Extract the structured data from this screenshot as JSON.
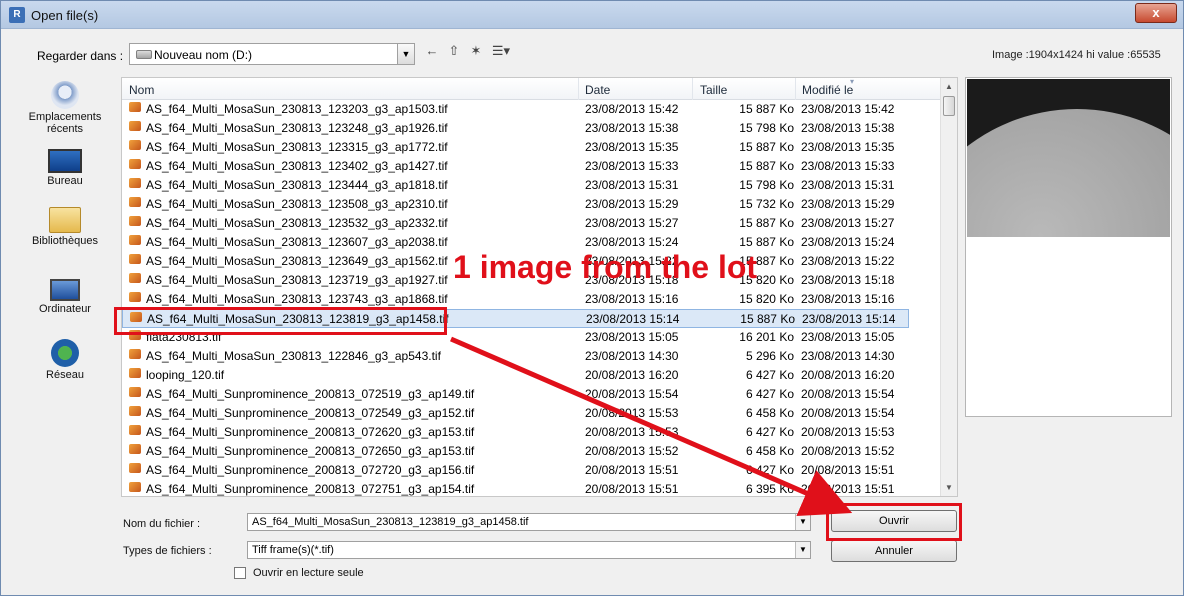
{
  "window": {
    "title": "Open file(s)",
    "app_icon": "R",
    "close": "x"
  },
  "lookin": {
    "label": "Regarder dans :",
    "value": "Nouveau nom (D:)"
  },
  "toolbar": {
    "back": "←",
    "up": "⇧",
    "newfolder": "✶",
    "views": "☰▾"
  },
  "imageinfo": "Image :1904x1424 hi value :65535",
  "places": [
    {
      "label": "Emplacements récents",
      "icon": "recent-places-icon"
    },
    {
      "label": "Bureau",
      "icon": "desktop-icon"
    },
    {
      "label": "Bibliothèques",
      "icon": "libraries-icon"
    },
    {
      "label": "Ordinateur",
      "icon": "computer-icon"
    },
    {
      "label": "Réseau",
      "icon": "network-icon"
    }
  ],
  "columns": {
    "name": "Nom",
    "date": "Date",
    "size": "Taille",
    "modified": "Modifié le"
  },
  "files": [
    {
      "name": "AS_f64_Multi_MosaSun_230813_123203_g3_ap1503.tif",
      "date": "23/08/2013 15:42",
      "size": "15 887 Ko",
      "modified": "23/08/2013 15:42"
    },
    {
      "name": "AS_f64_Multi_MosaSun_230813_123248_g3_ap1926.tif",
      "date": "23/08/2013 15:38",
      "size": "15 798 Ko",
      "modified": "23/08/2013 15:38"
    },
    {
      "name": "AS_f64_Multi_MosaSun_230813_123315_g3_ap1772.tif",
      "date": "23/08/2013 15:35",
      "size": "15 887 Ko",
      "modified": "23/08/2013 15:35"
    },
    {
      "name": "AS_f64_Multi_MosaSun_230813_123402_g3_ap1427.tif",
      "date": "23/08/2013 15:33",
      "size": "15 887 Ko",
      "modified": "23/08/2013 15:33"
    },
    {
      "name": "AS_f64_Multi_MosaSun_230813_123444_g3_ap1818.tif",
      "date": "23/08/2013 15:31",
      "size": "15 798 Ko",
      "modified": "23/08/2013 15:31"
    },
    {
      "name": "AS_f64_Multi_MosaSun_230813_123508_g3_ap2310.tif",
      "date": "23/08/2013 15:29",
      "size": "15 732 Ko",
      "modified": "23/08/2013 15:29"
    },
    {
      "name": "AS_f64_Multi_MosaSun_230813_123532_g3_ap2332.tif",
      "date": "23/08/2013 15:27",
      "size": "15 887 Ko",
      "modified": "23/08/2013 15:27"
    },
    {
      "name": "AS_f64_Multi_MosaSun_230813_123607_g3_ap2038.tif",
      "date": "23/08/2013 15:24",
      "size": "15 887 Ko",
      "modified": "23/08/2013 15:24"
    },
    {
      "name": "AS_f64_Multi_MosaSun_230813_123649_g3_ap1562.tif",
      "date": "23/08/2013 15:22",
      "size": "15 887 Ko",
      "modified": "23/08/2013 15:22"
    },
    {
      "name": "AS_f64_Multi_MosaSun_230813_123719_g3_ap1927.tif",
      "date": "23/08/2013 15:18",
      "size": "15 820 Ko",
      "modified": "23/08/2013 15:18"
    },
    {
      "name": "AS_f64_Multi_MosaSun_230813_123743_g3_ap1868.tif",
      "date": "23/08/2013 15:16",
      "size": "15 820 Ko",
      "modified": "23/08/2013 15:16"
    },
    {
      "name": "AS_f64_Multi_MosaSun_230813_123819_g3_ap1458.tif",
      "date": "23/08/2013 15:14",
      "size": "15 887 Ko",
      "modified": "23/08/2013 15:14",
      "selected": true
    },
    {
      "name": "flata230813.tif",
      "date": "23/08/2013 15:05",
      "size": "16 201 Ko",
      "modified": "23/08/2013 15:05"
    },
    {
      "name": "AS_f64_Multi_MosaSun_230813_122846_g3_ap543.tif",
      "date": "23/08/2013 14:30",
      "size": "5 296 Ko",
      "modified": "23/08/2013 14:30"
    },
    {
      "name": "looping_120.tif",
      "date": "20/08/2013 16:20",
      "size": "6 427 Ko",
      "modified": "20/08/2013 16:20"
    },
    {
      "name": "AS_f64_Multi_Sunprominence_200813_072519_g3_ap149.tif",
      "date": "20/08/2013 15:54",
      "size": "6 427 Ko",
      "modified": "20/08/2013 15:54"
    },
    {
      "name": "AS_f64_Multi_Sunprominence_200813_072549_g3_ap152.tif",
      "date": "20/08/2013 15:53",
      "size": "6 458 Ko",
      "modified": "20/08/2013 15:54"
    },
    {
      "name": "AS_f64_Multi_Sunprominence_200813_072620_g3_ap153.tif",
      "date": "20/08/2013 15:53",
      "size": "6 427 Ko",
      "modified": "20/08/2013 15:53"
    },
    {
      "name": "AS_f64_Multi_Sunprominence_200813_072650_g3_ap153.tif",
      "date": "20/08/2013 15:52",
      "size": "6 458 Ko",
      "modified": "20/08/2013 15:52"
    },
    {
      "name": "AS_f64_Multi_Sunprominence_200813_072720_g3_ap156.tif",
      "date": "20/08/2013 15:51",
      "size": "6 427 Ko",
      "modified": "20/08/2013 15:51"
    },
    {
      "name": "AS_f64_Multi_Sunprominence_200813_072751_g3_ap154.tif",
      "date": "20/08/2013 15:51",
      "size": "6 395 Ko",
      "modified": "20/08/2013 15:51"
    }
  ],
  "filename": {
    "label": "Nom du fichier :",
    "value": "AS_f64_Multi_MosaSun_230813_123819_g3_ap1458.tif"
  },
  "filetype": {
    "label": "Types de fichiers :",
    "value": "Tiff frame(s)(*.tif)"
  },
  "readonly": {
    "label": "Ouvrir en lecture seule"
  },
  "buttons": {
    "open": "Ouvrir",
    "cancel": "Annuler"
  },
  "annotation": {
    "text": "1 image from the lot",
    "color": "#e0101a"
  }
}
